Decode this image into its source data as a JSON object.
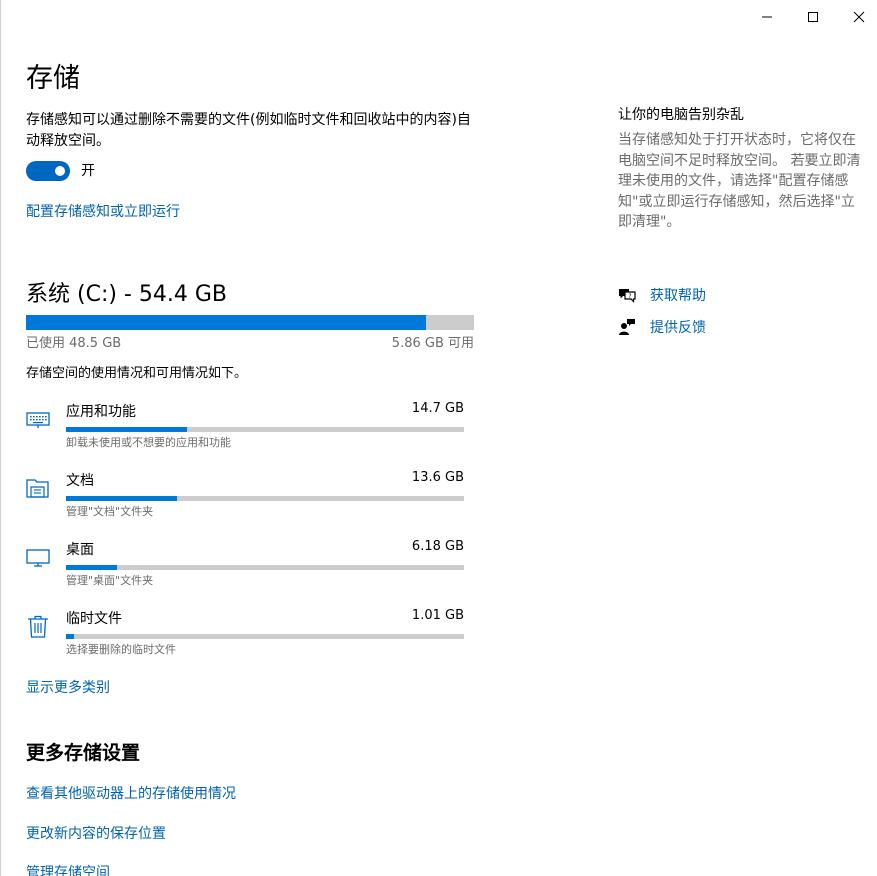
{
  "window": {
    "minimize_icon": "minimize-icon",
    "maximize_icon": "maximize-icon",
    "close_icon": "close-icon"
  },
  "page": {
    "title": "存储",
    "description": "存储感知可以通过删除不需要的文件(例如临时文件和回收站中的内容)自动释放空间。",
    "toggle_state": "开",
    "toggle_on": true,
    "configure_link": "配置存储感知或立即运行"
  },
  "drive": {
    "title": "系统 (C:) - 54.4 GB",
    "used_label": "已使用 48.5 GB",
    "free_label": "5.86 GB 可用",
    "used_fraction": 0.892,
    "summary": "存储空间的使用情况和可用情况如下。"
  },
  "categories": [
    {
      "name": "应用和功能",
      "size": "14.7 GB",
      "subtitle": "卸载未使用或不想要的应用和功能",
      "fraction": 0.303,
      "icon": "keyboard-icon"
    },
    {
      "name": "文档",
      "size": "13.6 GB",
      "subtitle": "管理\"文档\"文件夹",
      "fraction": 0.28,
      "icon": "documents-folder-icon"
    },
    {
      "name": "桌面",
      "size": "6.18 GB",
      "subtitle": "管理\"桌面\"文件夹",
      "fraction": 0.127,
      "icon": "monitor-icon"
    },
    {
      "name": "临时文件",
      "size": "1.01 GB",
      "subtitle": "选择要删除的临时文件",
      "fraction": 0.021,
      "icon": "trash-icon"
    }
  ],
  "show_more_link": "显示更多类别",
  "more_settings": {
    "title": "更多存储设置",
    "links": [
      "查看其他驱动器上的存储使用情况",
      "更改新内容的保存位置",
      "管理存储空间"
    ]
  },
  "sidebar": {
    "title": "让你的电脑告别杂乱",
    "description": "当存储感知处于打开状态时，它将仅在电脑空间不足时释放空间。 若要立即清理未使用的文件，请选择\"配置存储感知\"或立即运行存储感知，然后选择\"立即清理\"。",
    "help_label": "获取帮助",
    "help_icon": "chat-help-icon",
    "feedback_label": "提供反馈",
    "feedback_icon": "feedback-person-icon"
  },
  "colors": {
    "accent": "#0078d7",
    "link": "#0063b1",
    "bar_track": "#cccccc",
    "secondary_text": "#6b6b6b"
  }
}
